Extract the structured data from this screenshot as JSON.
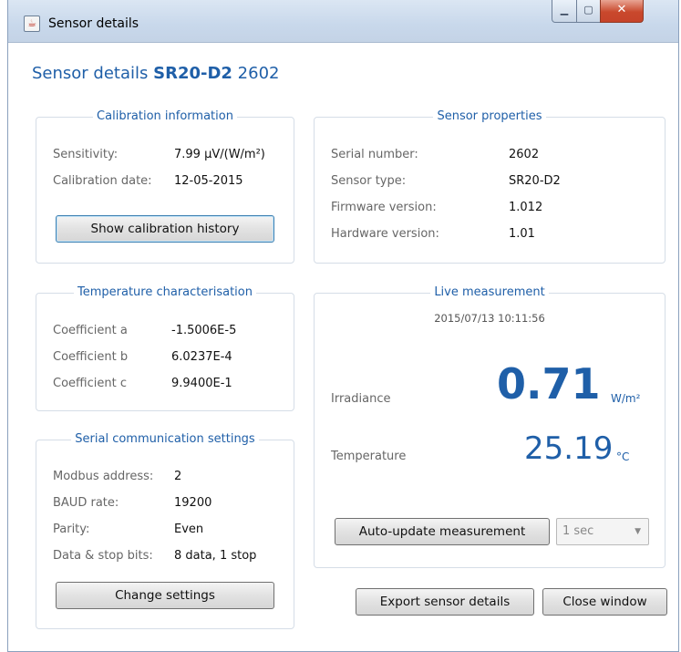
{
  "window": {
    "title": "Sensor details"
  },
  "header": {
    "prefix": "Sensor details",
    "model": "SR20-D2",
    "serial": "2602"
  },
  "calibration": {
    "title": "Calibration information",
    "sensitivity_label": "Sensitivity:",
    "sensitivity_value": "7.99 μV/(W/m²)",
    "date_label": "Calibration date:",
    "date_value": "12-05-2015",
    "history_button": "Show calibration history"
  },
  "properties": {
    "title": "Sensor properties",
    "rows": [
      {
        "label": "Serial number:",
        "value": "2602"
      },
      {
        "label": "Sensor type:",
        "value": "SR20-D2"
      },
      {
        "label": "Firmware version:",
        "value": "1.012"
      },
      {
        "label": "Hardware version:",
        "value": "1.01"
      }
    ]
  },
  "temperature_char": {
    "title": "Temperature characterisation",
    "rows": [
      {
        "label": "Coefficient a",
        "value": "-1.5006E-5"
      },
      {
        "label": "Coefficient b",
        "value": "6.0237E-4"
      },
      {
        "label": "Coefficient c",
        "value": "9.9400E-1"
      }
    ]
  },
  "live": {
    "title": "Live measurement",
    "timestamp": "2015/07/13 10:11:56",
    "irradiance_label": "Irradiance",
    "irradiance_value": "0.71",
    "irradiance_unit": "W/m²",
    "temperature_label": "Temperature",
    "temperature_value": "25.19",
    "temperature_unit": "°C",
    "auto_update_button": "Auto-update measurement",
    "interval_selected": "1 sec"
  },
  "serial_comm": {
    "title": "Serial communication settings",
    "rows": [
      {
        "label": "Modbus address:",
        "value": "2"
      },
      {
        "label": "BAUD rate:",
        "value": "19200"
      },
      {
        "label": "Parity:",
        "value": "Even"
      },
      {
        "label": "Data & stop bits:",
        "value": "8 data, 1 stop"
      }
    ],
    "change_button": "Change settings"
  },
  "footer": {
    "export_button": "Export sensor details",
    "close_button": "Close window"
  },
  "colors": {
    "accent": "#1f5fa8",
    "close": "#c9482c"
  }
}
